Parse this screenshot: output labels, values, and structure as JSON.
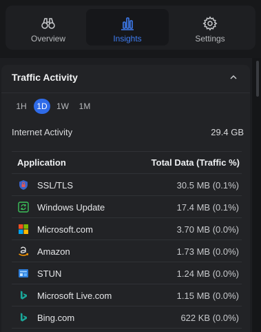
{
  "tabs": [
    {
      "label": "Overview",
      "icon": "binoculars-icon"
    },
    {
      "label": "Insights",
      "icon": "bar-chart-icon"
    },
    {
      "label": "Settings",
      "icon": "gear-icon"
    }
  ],
  "accent_color": "#3f7df2",
  "card": {
    "title": "Traffic Activity",
    "ranges": [
      "1H",
      "1D",
      "1W",
      "1M"
    ],
    "selected_range": "1D",
    "internet_activity_label": "Internet Activity",
    "internet_activity_value": "29.4 GB",
    "table": {
      "headers": [
        "Application",
        "Total Data (Traffic %)"
      ],
      "rows": [
        {
          "name": "SSL/TLS",
          "value": "30.5 MB (0.1%)",
          "icon": "shield-icon"
        },
        {
          "name": "Windows Update",
          "value": "17.4 MB (0.1%)",
          "icon": "update-icon"
        },
        {
          "name": "Microsoft.com",
          "value": "3.70 MB (0.0%)",
          "icon": "microsoft-logo-icon"
        },
        {
          "name": "Amazon",
          "value": "1.73 MB (0.0%)",
          "icon": "amazon-logo-icon"
        },
        {
          "name": "STUN",
          "value": "1.24 MB (0.0%)",
          "icon": "stun-icon"
        },
        {
          "name": "Microsoft Live.com",
          "value": "1.15 MB (0.0%)",
          "icon": "bing-logo-icon"
        },
        {
          "name": "Bing.com",
          "value": "622 KB (0.0%)",
          "icon": "bing-logo-icon"
        }
      ]
    }
  }
}
